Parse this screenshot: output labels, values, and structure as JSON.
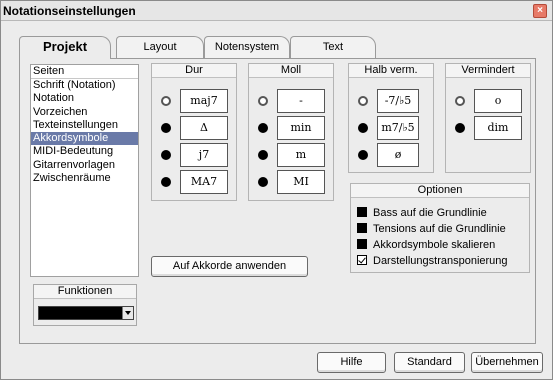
{
  "window": {
    "title": "Notationseinstellungen",
    "close_icon": "×"
  },
  "tabs": [
    {
      "label": "Projekt",
      "active": true
    },
    {
      "label": "Layout",
      "active": false
    },
    {
      "label": "Notensystem",
      "active": false
    },
    {
      "label": "Text",
      "active": false
    }
  ],
  "sidebar": {
    "header": "Seiten",
    "items": [
      "Schrift (Notation)",
      "Notation",
      "Vorzeichen",
      "Texteinstellungen",
      "Akkordsymbole",
      "MIDI-Bedeutung",
      "Gitarrenvorlagen",
      "Zwischenräume"
    ],
    "selected": "Akkordsymbole"
  },
  "functions": {
    "title": "Funktionen",
    "value": ""
  },
  "groups": {
    "dur": {
      "title": "Dur",
      "options": [
        "maj7",
        "Δ",
        "j7",
        "MA7"
      ],
      "selected_index": 0
    },
    "moll": {
      "title": "Moll",
      "options": [
        "-",
        "min",
        "m",
        "MI"
      ],
      "selected_index": 0
    },
    "halb": {
      "title": "Halb verm.",
      "options": [
        "-7/♭5",
        "m7/♭5",
        "ø"
      ],
      "selected_index": 0
    },
    "verm": {
      "title": "Vermindert",
      "options": [
        "o",
        "dim"
      ],
      "selected_index": 0
    }
  },
  "apply_button": "Auf Akkorde anwenden",
  "options": {
    "title": "Optionen",
    "items": [
      {
        "label": "Bass auf die Grundlinie",
        "checked": false
      },
      {
        "label": "Tensions auf die Grundlinie",
        "checked": false
      },
      {
        "label": "Akkordsymbole skalieren",
        "checked": false
      },
      {
        "label": "Darstellungstransponierung",
        "checked": true
      }
    ]
  },
  "footer": {
    "help": "Hilfe",
    "standard": "Standard",
    "apply": "Übernehmen"
  }
}
